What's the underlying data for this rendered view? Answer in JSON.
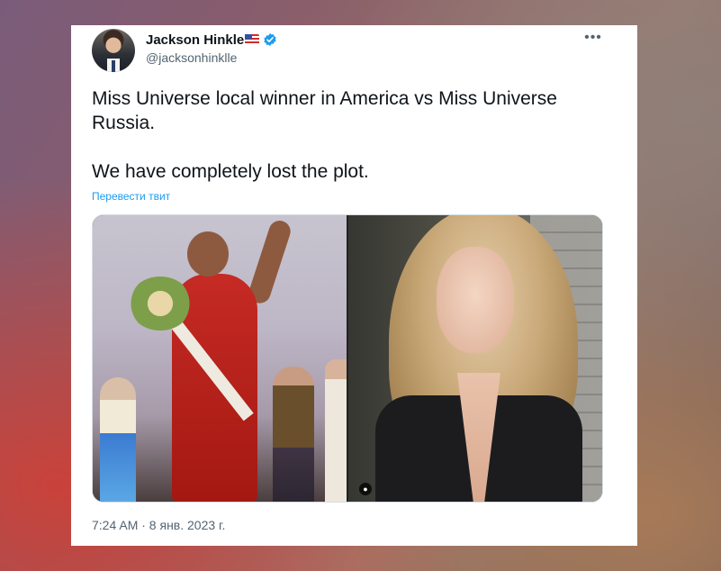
{
  "author": {
    "name": "Jackson Hinkle",
    "handle": "@jacksonhinklle",
    "flag": "us-flag-emoji",
    "verified": true,
    "avatar_icon": "avatar-photo"
  },
  "menu": {
    "more_label": "•••"
  },
  "tweet": {
    "lines": [
      "Miss Universe local winner in America vs Miss Universe Russia.",
      "We have completely lost the plot."
    ],
    "translate_link": "Перевести твит",
    "timestamp": "7:24 AM · 8 янв. 2023 г."
  },
  "media": {
    "images": [
      {
        "name": "pageant-stage-photo"
      },
      {
        "name": "blonde-woman-portrait",
        "badge_icon": "alt-badge-icon"
      }
    ]
  },
  "colors": {
    "link": "#1d9bf0",
    "text": "#0f1419",
    "secondary": "#536471",
    "verified": "#1d9bf0"
  }
}
